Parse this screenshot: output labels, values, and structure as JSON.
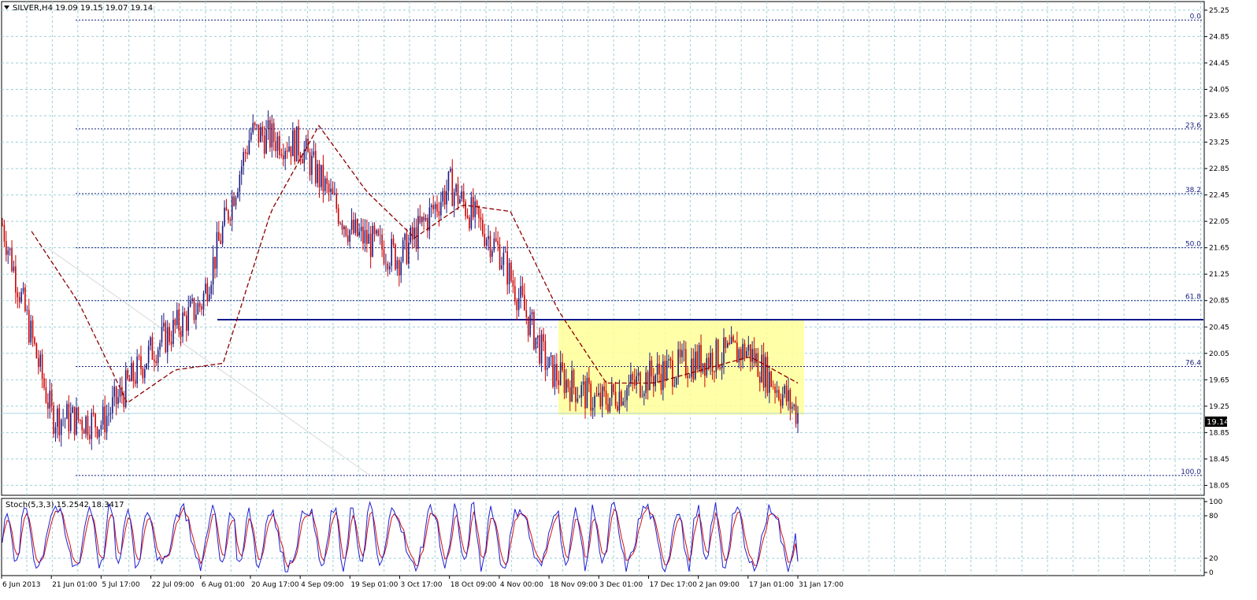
{
  "header": {
    "menu_icon": "triangle-down-icon",
    "symbol_label": "SILVER,H4  19.09 19.15 19.07 19.14"
  },
  "indicator": {
    "label": "Stoch(5,3,3) 15.2542 18.3417"
  },
  "colors": {
    "background": "#ffffff",
    "grid": "#9ecfd8",
    "candle": "#cc0000",
    "candle_dark": "#1a1a80",
    "ma": "#8b0000",
    "fib": "#1a237e",
    "support": "#0a1a8c",
    "box_fill": "#ffff99",
    "price_tag_bg": "#000000",
    "stoch_main": "#1f1fd0",
    "stoch_signal": "#d01010"
  },
  "chart_data": [
    {
      "type": "line",
      "title": "SILVER,H4  19.09 19.15 19.07 19.14",
      "timeframe": "H4",
      "ohlc_last": {
        "open": 19.09,
        "high": 19.15,
        "low": 19.07,
        "close": 19.14
      },
      "current_price": "19.14",
      "x_tick_labels": [
        "6 Jun 2013",
        "21 Jun 01:00",
        "5 Jul 17:00",
        "22 Jul 09:00",
        "6 Aug 01:00",
        "20 Aug 17:00",
        "4 Sep 09:00",
        "19 Sep 01:00",
        "3 Oct 17:00",
        "18 Oct 09:00",
        "4 Nov 00:00",
        "18 Nov 09:00",
        "3 Dec 01:00",
        "17 Dec 17:00",
        "2 Jan 09:00",
        "17 Jan 01:00",
        "31 Jan 17:00"
      ],
      "y_tick_labels": [
        "25.25",
        "24.85",
        "24.45",
        "24.05",
        "23.65",
        "23.25",
        "22.85",
        "22.45",
        "22.05",
        "21.65",
        "21.25",
        "20.85",
        "20.45",
        "20.05",
        "19.65",
        "19.25",
        "18.85",
        "18.45",
        "18.05"
      ],
      "ylim": [
        17.9,
        25.38
      ],
      "grid": true,
      "series": [
        {
          "x": [
            "6 Jun 2013",
            "21 Jun 01:00",
            "5 Jul 17:00",
            "22 Jul 09:00",
            "6 Aug 01:00",
            "20 Aug 17:00",
            "4 Sep 09:00",
            "19 Sep 01:00",
            "3 Oct 17:00",
            "18 Oct 09:00",
            "4 Nov 00:00",
            "18 Nov 09:00",
            "3 Dec 01:00",
            "17 Dec 17:00",
            "2 Jan 09:00",
            "17 Jan 01:00",
            "31 Jan 17:00"
          ],
          "values": [
            22.0,
            19.1,
            19.0,
            20.1,
            20.8,
            23.4,
            23.2,
            21.9,
            21.5,
            22.6,
            21.6,
            19.8,
            19.3,
            19.7,
            19.95,
            20.1,
            19.14
          ]
        },
        {
          "x": [
            "6 Jun 2013",
            "21 Jun 01:00",
            "5 Jul 17:00",
            "22 Jul 09:00",
            "6 Aug 01:00",
            "20 Aug 17:00",
            "4 Sep 09:00",
            "19 Sep 01:00",
            "3 Oct 17:00",
            "18 Oct 09:00",
            "4 Nov 00:00",
            "18 Nov 09:00",
            "3 Dec 01:00",
            "17 Dec 17:00",
            "2 Jan 09:00",
            "17 Jan 01:00",
            "31 Jan 17:00"
          ],
          "values": [
            21.9,
            20.8,
            19.3,
            19.8,
            19.9,
            22.2,
            23.5,
            22.5,
            21.8,
            22.3,
            22.2,
            20.7,
            19.6,
            19.6,
            19.8,
            20.0,
            19.6
          ]
        }
      ],
      "fib_levels": [
        {
          "label": "0.0",
          "price": 25.1
        },
        {
          "label": "23.6",
          "price": 23.45
        },
        {
          "label": "38.2",
          "price": 22.47
        },
        {
          "label": "50.0",
          "price": 21.65
        },
        {
          "label": "61.8",
          "price": 20.85
        },
        {
          "label": "76.4",
          "price": 19.85
        },
        {
          "label": "100.0",
          "price": 18.2
        }
      ],
      "support_level": 20.56,
      "range_box": {
        "from": "18 Nov 09:00",
        "to": "31 Jan 17:00",
        "high": 20.56,
        "low": 19.12
      }
    },
    {
      "type": "line",
      "title": "Stoch(5,3,3) 15.2542 18.3417",
      "main_value": 15.2542,
      "signal_value": 18.3417,
      "ylim": [
        0,
        100
      ],
      "y_tick_labels": [
        "100",
        "80",
        "20",
        "0"
      ],
      "levels": [
        80,
        20
      ]
    }
  ]
}
